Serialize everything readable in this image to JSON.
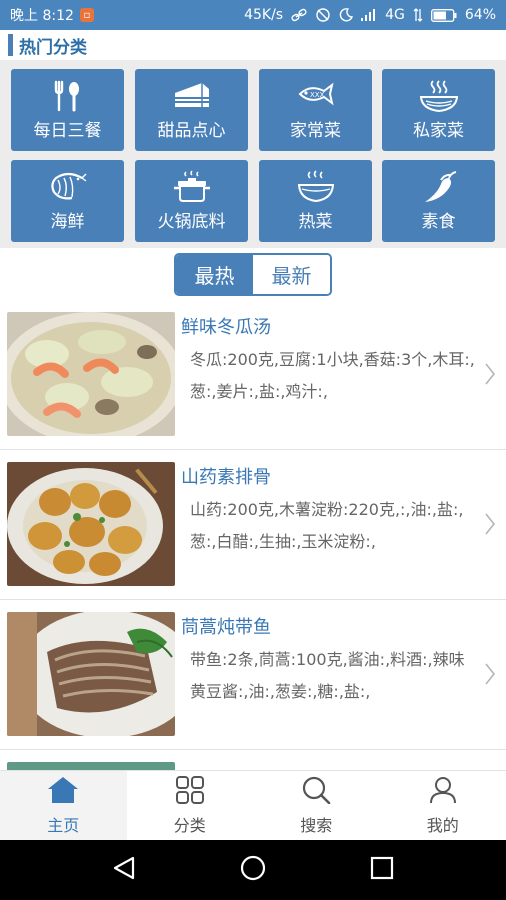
{
  "status_bar": {
    "time": "晚上 8:12",
    "speed": "45K/s",
    "network": "4G",
    "battery": "64%"
  },
  "section": {
    "title": "热门分类"
  },
  "categories": [
    {
      "label": "每日三餐",
      "icon": "fork-spoon-icon"
    },
    {
      "label": "甜品点心",
      "icon": "cake-icon"
    },
    {
      "label": "家常菜",
      "icon": "fish-icon"
    },
    {
      "label": "私家菜",
      "icon": "noodle-bowl-icon"
    },
    {
      "label": "海鲜",
      "icon": "shrimp-icon"
    },
    {
      "label": "火锅底料",
      "icon": "hotpot-icon"
    },
    {
      "label": "热菜",
      "icon": "steaming-bowl-icon"
    },
    {
      "label": "素食",
      "icon": "chili-icon"
    }
  ],
  "toggle": {
    "hot": "最热",
    "new": "最新"
  },
  "recipes": [
    {
      "title": "鲜味冬瓜汤",
      "ingredients": "冬瓜:200克,豆腐:1小块,香菇:3个,木耳:,葱:,姜片:,盐:,鸡汁:,"
    },
    {
      "title": "山药素排骨",
      "ingredients": "山药:200克,木薯淀粉:220克,:,油:,盐:,葱:,白醋:,生抽:,玉米淀粉:,"
    },
    {
      "title": "茼蒿炖带鱼",
      "ingredients": "带鱼:2条,茼蒿:100克,酱油:,料酒:,辣味黄豆酱:,油:,葱姜:,糖:,盐:,"
    }
  ],
  "nav": {
    "home": "主页",
    "category": "分类",
    "search": "搜索",
    "mine": "我的"
  },
  "colors": {
    "primary": "#4a80b8",
    "status_bar": "#4a86bd",
    "accent_text": "#3a78b5"
  }
}
